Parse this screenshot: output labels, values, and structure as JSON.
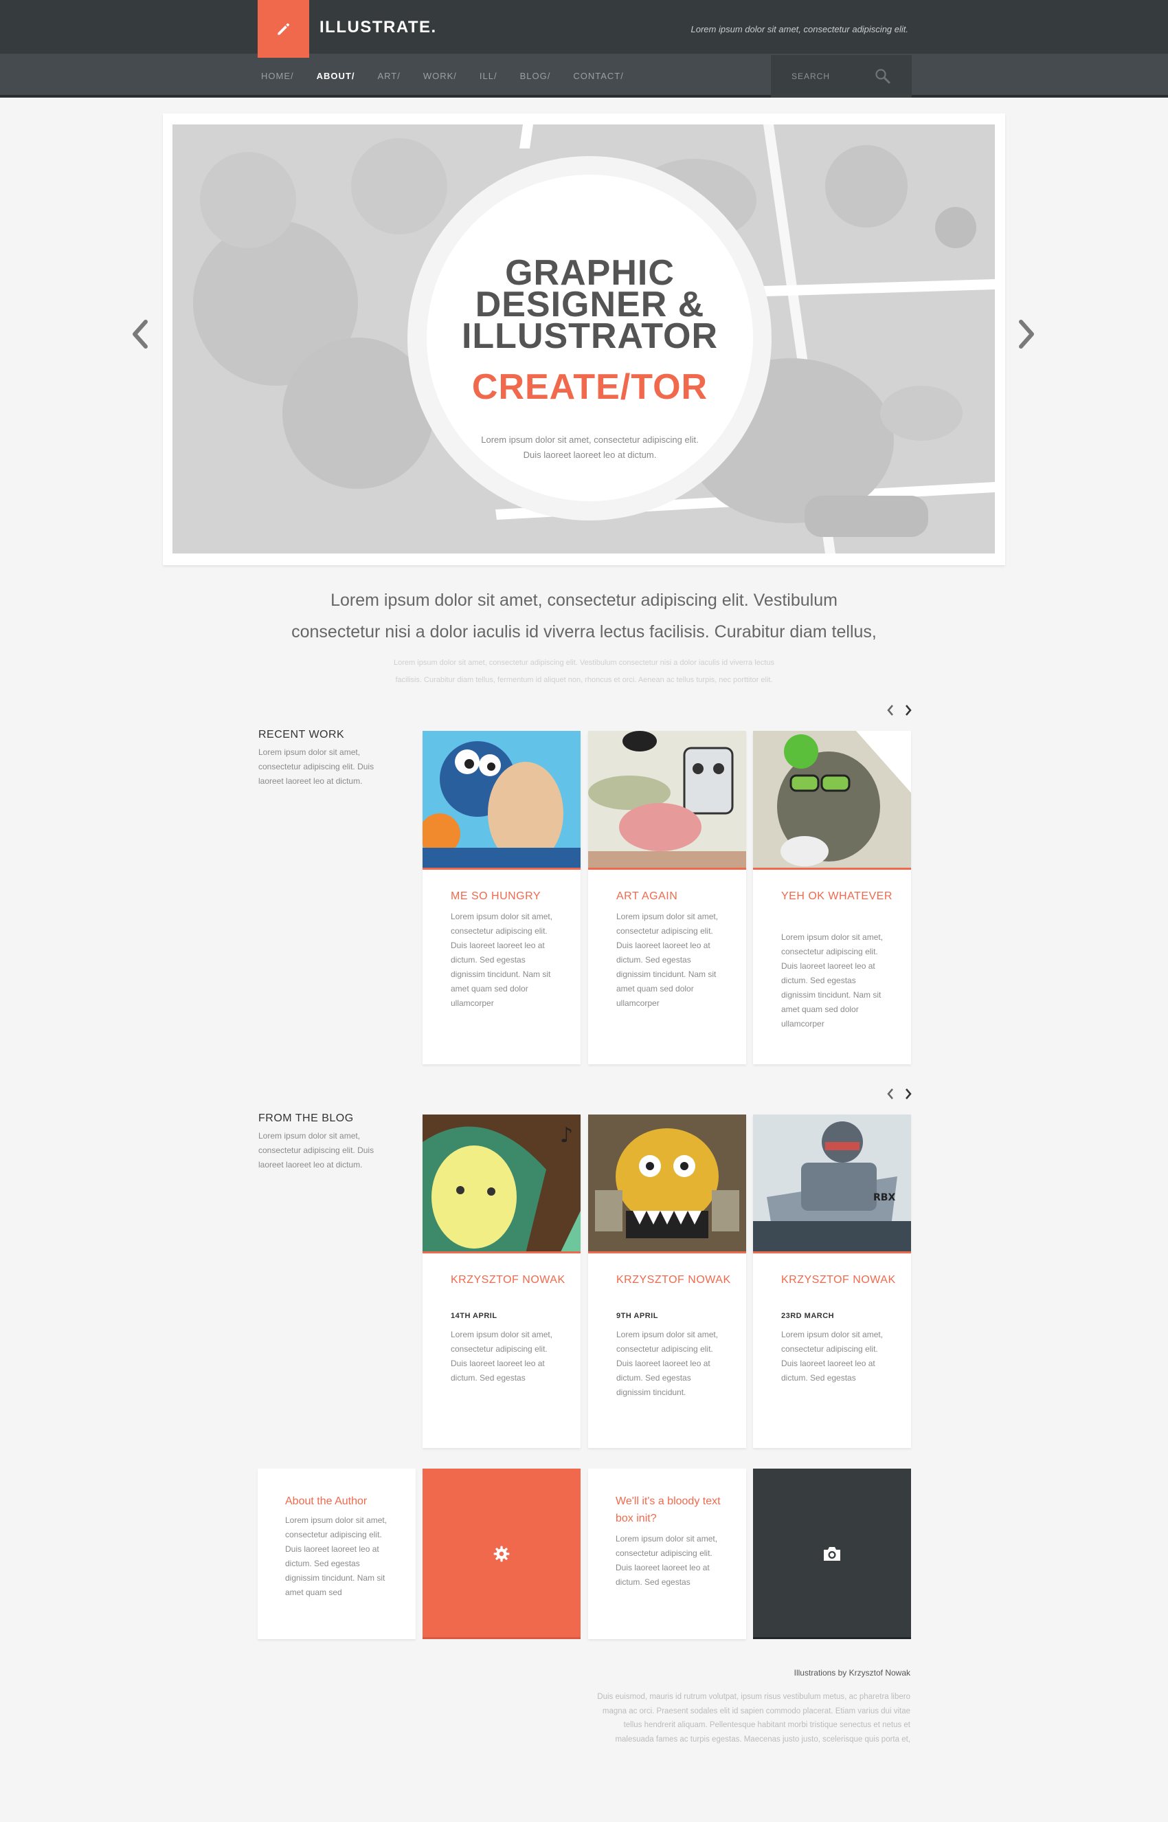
{
  "header": {
    "logo_icon": "pencil-icon",
    "brand": "ILLUSTRATE.",
    "tagline": "Lorem ipsum dolor sit amet, consectetur adipiscing elit.",
    "accent_color": "#f1694d",
    "nav": [
      "HOME/",
      "ABOUT/",
      "ART/",
      "WORK/",
      "ILL/",
      "BLOG/",
      "CONTACT/"
    ],
    "nav_active": "ABOUT/",
    "search_placeholder": "SEARCH"
  },
  "hero": {
    "title_lines": [
      "GRAPHIC",
      "DESIGNER &",
      "ILLUSTRATOR"
    ],
    "accent": "CREATE/TOR",
    "subtitle_lines": [
      "Lorem ipsum dolor sit amet, consectetur adipiscing elit.",
      "Duis laoreet laoreet leo at dictum."
    ],
    "prev_icon": "chevron-left-icon",
    "next_icon": "chevron-right-icon"
  },
  "intro": {
    "lead_lines": [
      "Lorem ipsum dolor sit amet, consectetur adipiscing elit. Vestibulum",
      "consectetur nisi a dolor iaculis id viverra lectus facilisis. Curabitur diam tellus,"
    ],
    "small_lines": [
      "Lorem ipsum dolor sit amet, consectetur adipiscing elit. Vestibulum consectetur nisi a dolor iaculis id viverra lectus",
      "facilisis. Curabitur diam tellus, fermentum id aliquet non, rhoncus et orci. Aenean ac tellus turpis, nec porttitor elit."
    ]
  },
  "recent_work": {
    "title": "RECENT WORK",
    "desc": "Lorem ipsum dolor sit amet, consectetur adipiscing elit. Duis laoreet laoreet leo at dictum.",
    "cards": [
      {
        "title": "ME SO HUNGRY",
        "text": "Lorem ipsum dolor sit amet, consectetur adipiscing elit. Duis laoreet laoreet leo at dictum. Sed egestas dignissim tincidunt. Nam sit amet quam sed dolor ullamcorper"
      },
      {
        "title": "ART AGAIN",
        "text": "Lorem ipsum dolor sit amet, consectetur adipiscing elit. Duis laoreet laoreet leo at dictum. Sed egestas dignissim tincidunt. Nam sit amet quam sed dolor ullamcorper"
      },
      {
        "title": "YEH OK WHATEVER",
        "text": "Lorem ipsum dolor sit amet, consectetur adipiscing elit. Duis laoreet laoreet leo at dictum. Sed egestas dignissim tincidunt. Nam sit amet quam sed dolor ullamcorper"
      }
    ]
  },
  "blog": {
    "title": "FROM THE BLOG",
    "desc": "Lorem ipsum dolor sit amet, consectetur adipiscing elit. Duis laoreet laoreet leo at dictum.",
    "cards": [
      {
        "title": "KRZYSZTOF NOWAK",
        "date": "14TH APRIL",
        "text": "Lorem ipsum dolor sit amet, consectetur adipiscing elit. Duis laoreet laoreet leo at dictum. Sed egestas"
      },
      {
        "title": "KRZYSZTOF NOWAK",
        "date": "9TH APRIL",
        "text": "Lorem ipsum dolor sit amet, consectetur adipiscing elit. Duis laoreet laoreet leo at dictum. Sed egestas dignissim tincidunt."
      },
      {
        "title": "KRZYSZTOF NOWAK",
        "date": "23RD MARCH",
        "text": "Lorem ipsum dolor sit amet, consectetur adipiscing elit. Duis laoreet laoreet leo at dictum. Sed egestas"
      }
    ]
  },
  "blocks": {
    "author_title": "About the Author",
    "author_text": "Lorem ipsum dolor sit amet, consectetur adipiscing elit. Duis laoreet laoreet leo at dictum. Sed egestas dignissim tincidunt. Nam sit amet quam sed",
    "gear_icon": "gear-icon",
    "box_title": "We'll it's a bloody text box init?",
    "box_text": "Lorem ipsum dolor sit amet, consectetur adipiscing elit. Duis laoreet laoreet leo at dictum. Sed egestas",
    "camera_icon": "camera-icon"
  },
  "footer": {
    "credit": "Illustrations by Krzysztof Nowak",
    "text_lines": [
      "Duis euismod, mauris id rutrum volutpat, ipsum risus vestibulum metus, ac pharetra libero",
      "magna ac orci. Praesent sodales elit id sapien commodo placerat. Etiam varius dui vitae",
      "tellus hendrerit aliquam. Pellentesque habitant morbi tristique senectus et netus et",
      "malesuada fames ac turpis egestas. Maecenas justo justo, scelerisque quis porta et,"
    ]
  }
}
